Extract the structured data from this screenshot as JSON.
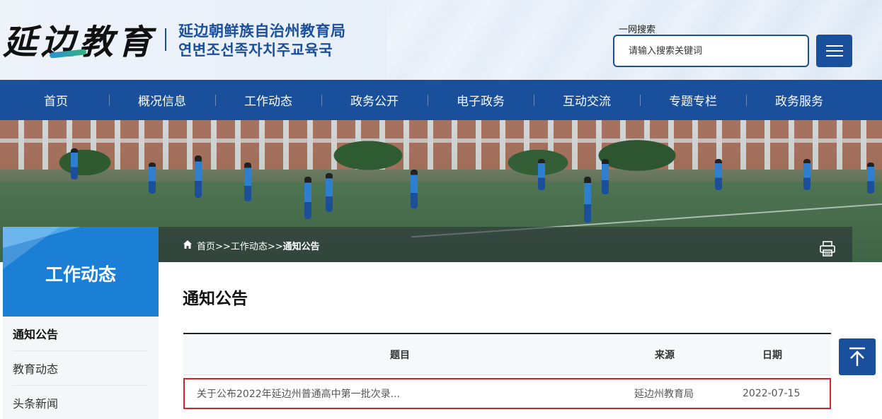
{
  "header": {
    "logo_calligraphy": "延边教育",
    "org_name_cn": "延边朝鲜族自治州教育局",
    "org_name_kr": "연변조선족자치주교육국",
    "search_label": "一网搜索",
    "search_placeholder": "请输入搜索关键词",
    "menu_icon": "hamburger-icon"
  },
  "nav": {
    "items": [
      "首页",
      "概况信息",
      "工作动态",
      "政务公开",
      "电子政务",
      "互动交流",
      "专题专栏",
      "政务服务"
    ]
  },
  "breadcrumb": {
    "home": "首页",
    "sep": ">>",
    "section": "工作动态",
    "current": "通知公告"
  },
  "sidebar": {
    "title": "工作动态",
    "items": [
      {
        "label": "通知公告",
        "active": true
      },
      {
        "label": "教育动态",
        "active": false
      },
      {
        "label": "头条新闻",
        "active": false
      }
    ]
  },
  "main": {
    "title": "通知公告",
    "table": {
      "headers": {
        "title": "题目",
        "source": "来源",
        "date": "日期"
      },
      "rows": [
        {
          "title": "关于公布2022年延边州普通高中第一批次录...",
          "source": "延边州教育局",
          "date": "2022-07-15"
        }
      ]
    }
  },
  "colors": {
    "primary": "#1a4f9c",
    "sidebar_head": "#1c7fd6",
    "highlight_border": "#d9202a"
  }
}
